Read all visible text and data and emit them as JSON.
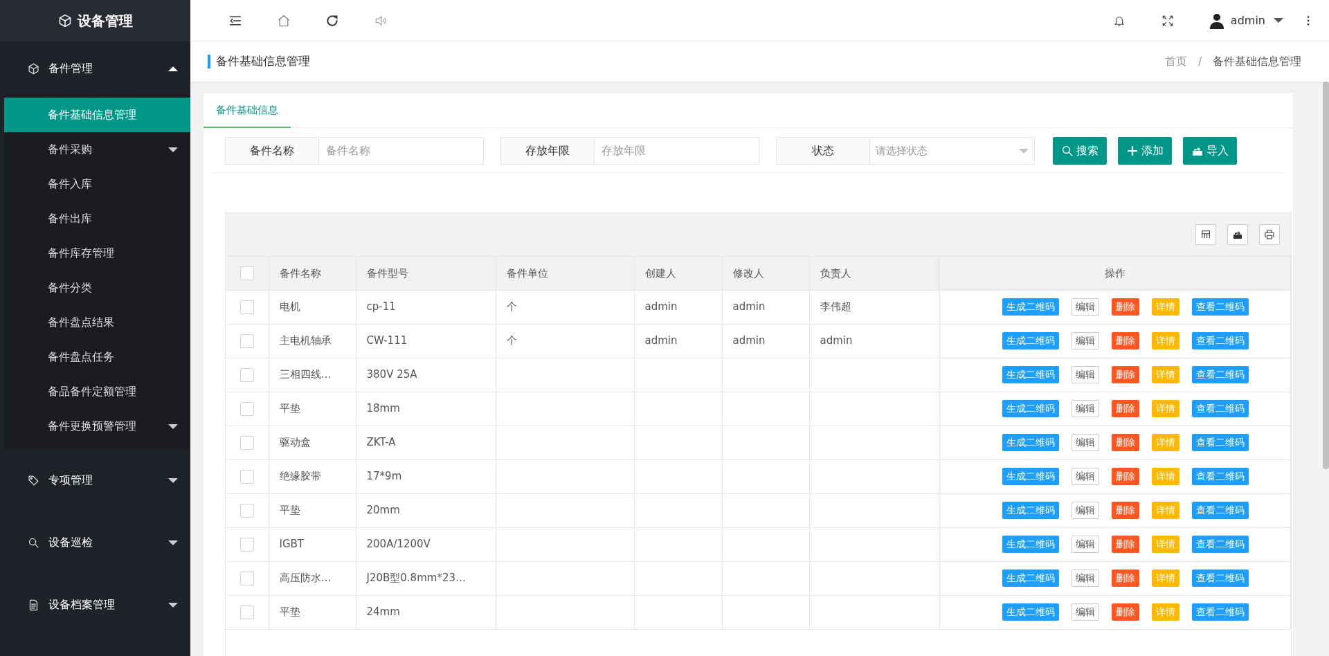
{
  "sidebar": {
    "title": "设备管理",
    "menus": [
      {
        "label": "备件管理",
        "expanded": true,
        "children": [
          {
            "label": "备件基础信息管理",
            "selected": true,
            "has_submenu": false
          },
          {
            "label": "备件采购",
            "selected": false,
            "has_submenu": true
          },
          {
            "label": "备件入库",
            "selected": false,
            "has_submenu": false
          },
          {
            "label": "备件出库",
            "selected": false,
            "has_submenu": false
          },
          {
            "label": "备件库存管理",
            "selected": false,
            "has_submenu": false
          },
          {
            "label": "备件分类",
            "selected": false,
            "has_submenu": false
          },
          {
            "label": "备件盘点结果",
            "selected": false,
            "has_submenu": false
          },
          {
            "label": "备件盘点任务",
            "selected": false,
            "has_submenu": false
          },
          {
            "label": "备品备件定额管理",
            "selected": false,
            "has_submenu": false
          },
          {
            "label": "备件更换预警管理",
            "selected": false,
            "has_submenu": true
          }
        ]
      },
      {
        "label": "专项管理",
        "expanded": false
      },
      {
        "label": "设备巡检",
        "expanded": false
      },
      {
        "label": "设备档案管理",
        "expanded": false
      }
    ]
  },
  "topbar": {
    "user": "admin"
  },
  "page_header": {
    "title": "备件基础信息管理",
    "separator": "/",
    "breadcrumb": [
      {
        "label": "首页",
        "current": false
      },
      {
        "label": "备件基础信息管理",
        "current": true
      }
    ]
  },
  "tabs": [
    {
      "label": "备件基础信息",
      "selected": true
    }
  ],
  "filters": [
    {
      "label": "备件名称",
      "placeholder": "备件名称",
      "kind": "input"
    },
    {
      "label": "存放年限",
      "placeholder": "存放年限",
      "kind": "input"
    },
    {
      "label": "状态",
      "placeholder": "请选择状态",
      "kind": "select"
    }
  ],
  "buttons": [
    {
      "label": "搜索"
    },
    {
      "label": "添加"
    },
    {
      "label": "导入"
    }
  ],
  "table": {
    "header_checked": false,
    "columns": [
      "备件名称",
      "备件型号",
      "备件单位",
      "创建人",
      "修改人",
      "负责人",
      "操作"
    ],
    "rows": [
      {
        "checked": false,
        "cells": [
          "电机",
          "cp-11",
          "个",
          "admin",
          "admin",
          "李伟超"
        ],
        "actions": [
          {
            "label": "生成二维码",
            "kind": "primary"
          },
          {
            "label": "编辑",
            "kind": "plain"
          },
          {
            "label": "删除",
            "kind": "danger"
          },
          {
            "label": "详情",
            "kind": "warning"
          },
          {
            "label": "查看二维码",
            "kind": "primary"
          }
        ]
      },
      {
        "checked": false,
        "cells": [
          "主电机轴承",
          "CW-111",
          "个",
          "admin",
          "admin",
          "admin"
        ],
        "actions": [
          {
            "label": "生成二维码",
            "kind": "primary"
          },
          {
            "label": "编辑",
            "kind": "plain"
          },
          {
            "label": "删除",
            "kind": "danger"
          },
          {
            "label": "详情",
            "kind": "warning"
          },
          {
            "label": "查看二维码",
            "kind": "primary"
          }
        ]
      },
      {
        "checked": false,
        "cells": [
          "三相四线…",
          "380V 25A"
        ],
        "actions": [
          {
            "label": "生成二维码",
            "kind": "primary"
          },
          {
            "label": "编辑",
            "kind": "plain"
          },
          {
            "label": "删除",
            "kind": "danger"
          },
          {
            "label": "详情",
            "kind": "warning"
          },
          {
            "label": "查看二维码",
            "kind": "primary"
          }
        ]
      },
      {
        "checked": false,
        "cells": [
          "平垫",
          "18mm"
        ],
        "actions": [
          {
            "label": "生成二维码",
            "kind": "primary"
          },
          {
            "label": "编辑",
            "kind": "plain"
          },
          {
            "label": "删除",
            "kind": "danger"
          },
          {
            "label": "详情",
            "kind": "warning"
          },
          {
            "label": "查看二维码",
            "kind": "primary"
          }
        ]
      },
      {
        "checked": false,
        "cells": [
          "驱动盒",
          "ZKT-A"
        ],
        "actions": [
          {
            "label": "生成二维码",
            "kind": "primary"
          },
          {
            "label": "编辑",
            "kind": "plain"
          },
          {
            "label": "删除",
            "kind": "danger"
          },
          {
            "label": "详情",
            "kind": "warning"
          },
          {
            "label": "查看二维码",
            "kind": "primary"
          }
        ]
      },
      {
        "checked": false,
        "cells": [
          "绝缘胶带",
          "17*9m"
        ],
        "actions": [
          {
            "label": "生成二维码",
            "kind": "primary"
          },
          {
            "label": "编辑",
            "kind": "plain"
          },
          {
            "label": "删除",
            "kind": "danger"
          },
          {
            "label": "详情",
            "kind": "warning"
          },
          {
            "label": "查看二维码",
            "kind": "primary"
          }
        ]
      },
      {
        "checked": false,
        "cells": [
          "平垫",
          "20mm"
        ],
        "actions": [
          {
            "label": "生成二维码",
            "kind": "primary"
          },
          {
            "label": "编辑",
            "kind": "plain"
          },
          {
            "label": "删除",
            "kind": "danger"
          },
          {
            "label": "详情",
            "kind": "warning"
          },
          {
            "label": "查看二维码",
            "kind": "primary"
          }
        ]
      },
      {
        "checked": false,
        "cells": [
          "IGBT",
          "200A/1200V"
        ],
        "actions": [
          {
            "label": "生成二维码",
            "kind": "primary"
          },
          {
            "label": "编辑",
            "kind": "plain"
          },
          {
            "label": "删除",
            "kind": "danger"
          },
          {
            "label": "详情",
            "kind": "warning"
          },
          {
            "label": "查看二维码",
            "kind": "primary"
          }
        ]
      },
      {
        "checked": false,
        "cells": [
          "高压防水…",
          "J20B型0.8mm*23…"
        ],
        "actions": [
          {
            "label": "生成二维码",
            "kind": "primary"
          },
          {
            "label": "编辑",
            "kind": "plain"
          },
          {
            "label": "删除",
            "kind": "danger"
          },
          {
            "label": "详情",
            "kind": "warning"
          },
          {
            "label": "查看二维码",
            "kind": "primary"
          }
        ]
      },
      {
        "checked": false,
        "cells": [
          "平垫",
          "24mm"
        ],
        "actions": [
          {
            "label": "生成二维码",
            "kind": "primary"
          },
          {
            "label": "编辑",
            "kind": "plain"
          },
          {
            "label": "删除",
            "kind": "danger"
          },
          {
            "label": "详情",
            "kind": "warning"
          },
          {
            "label": "查看二维码",
            "kind": "primary"
          }
        ]
      }
    ]
  }
}
